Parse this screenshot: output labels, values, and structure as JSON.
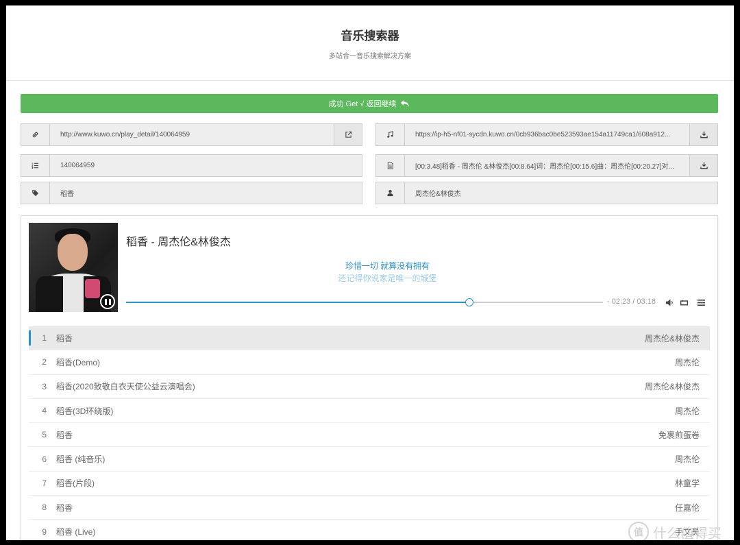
{
  "header": {
    "title": "音乐搜索器",
    "subtitle": "多站合一音乐搜索解决方案"
  },
  "success_bar": {
    "label": "成功 Get √ 返回继续"
  },
  "fields": {
    "link": "http://www.kuwo.cn/play_detail/140064959",
    "music_url": "https://ip-h5-nf01-sycdn.kuwo.cn/0cb936bac0be523593ae154a11749ca1/608a912...",
    "song_id": "140064959",
    "lyrics": "[00:3.48]稻香 - 周杰伦 &林俊杰[00:8.64]词：周杰伦[00:15.6]曲：周杰伦[00:20.27]对...",
    "song_name": "稻香",
    "artist": "周杰伦&林俊杰"
  },
  "player": {
    "title": "稻香 - 周杰伦&林俊杰",
    "lyric_current": "珍惜一切 就算没有拥有",
    "lyric_next": "还记得你说家是唯一的城堡",
    "time_display": "- 02:23 / 03:18",
    "progress": 0.72,
    "accent": "#2a90c8"
  },
  "playlist": [
    {
      "num": "1",
      "name": "稻香",
      "artist": "周杰伦&林俊杰",
      "active": true
    },
    {
      "num": "2",
      "name": "稻香(Demo)",
      "artist": "周杰伦"
    },
    {
      "num": "3",
      "name": "稻香(2020致敬白衣天使公益云演唱会)",
      "artist": "周杰伦&林俊杰"
    },
    {
      "num": "4",
      "name": "稻香(3D环绕版)",
      "artist": "周杰伦"
    },
    {
      "num": "5",
      "name": "稻香",
      "artist": "免裹煎蛋卷"
    },
    {
      "num": "6",
      "name": "稻香 (纯音乐)",
      "artist": "周杰伦"
    },
    {
      "num": "7",
      "name": "稻香(片段)",
      "artist": "林童学"
    },
    {
      "num": "8",
      "name": "稻香",
      "artist": "任嘉伦"
    },
    {
      "num": "9",
      "name": "稻香 (Live)",
      "artist": "手文昊"
    }
  ],
  "watermark": {
    "logo": "值",
    "text": "什么值得买"
  },
  "icons": {
    "link": "link-icon",
    "external": "external-link-icon",
    "music": "music-note-icon",
    "download": "download-icon",
    "list": "list-ol-icon",
    "file": "file-text-icon",
    "tag": "tag-icon",
    "user": "user-icon",
    "volume": "volume-icon",
    "loop": "loop-icon",
    "menu": "menu-icon"
  },
  "colors": {
    "success": "#5cb85c",
    "accent": "#2a90c8"
  }
}
